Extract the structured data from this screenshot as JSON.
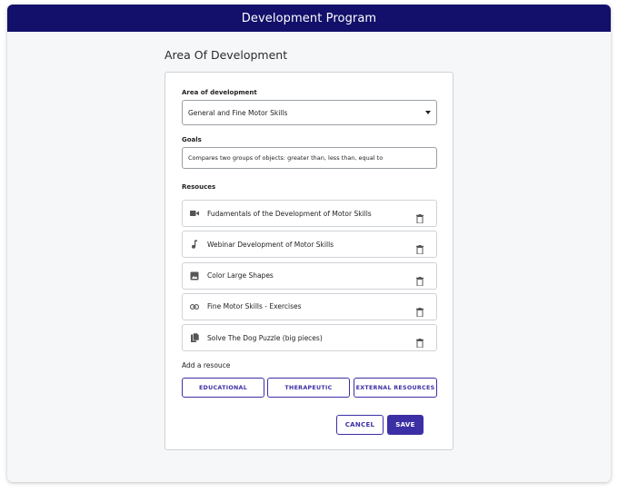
{
  "window": {
    "title": "Development Program"
  },
  "page": {
    "heading": "Area Of Development"
  },
  "form": {
    "area_label": "Area of development",
    "area_value": "General and Fine Motor Skills",
    "goals_label": "Goals",
    "goals_value": "Compares two groups of objects: greater than, less than, equal to",
    "resources_label": "Resouces",
    "resources": [
      {
        "icon": "video-icon",
        "label": "Fudamentals of the Development of Motor Skills"
      },
      {
        "icon": "music-note-icon",
        "label": "Webinar Development of Motor Skills"
      },
      {
        "icon": "image-icon",
        "label": "Color Large Shapes"
      },
      {
        "icon": "link-icon",
        "label": "Fine Motor Skills - Exercises"
      },
      {
        "icon": "document-icon",
        "label": "Solve The Dog Puzzle (big pieces)"
      }
    ],
    "add_resource_label": "Add a resouce",
    "add_buttons": [
      "EDUCATIONAL",
      "THERAPEUTIC",
      "EXTERNAL RESOURCES"
    ],
    "cancel_label": "CANCEL",
    "save_label": "SAVE"
  },
  "colors": {
    "titlebar": "#12106a",
    "accent": "#3c2fa6"
  }
}
